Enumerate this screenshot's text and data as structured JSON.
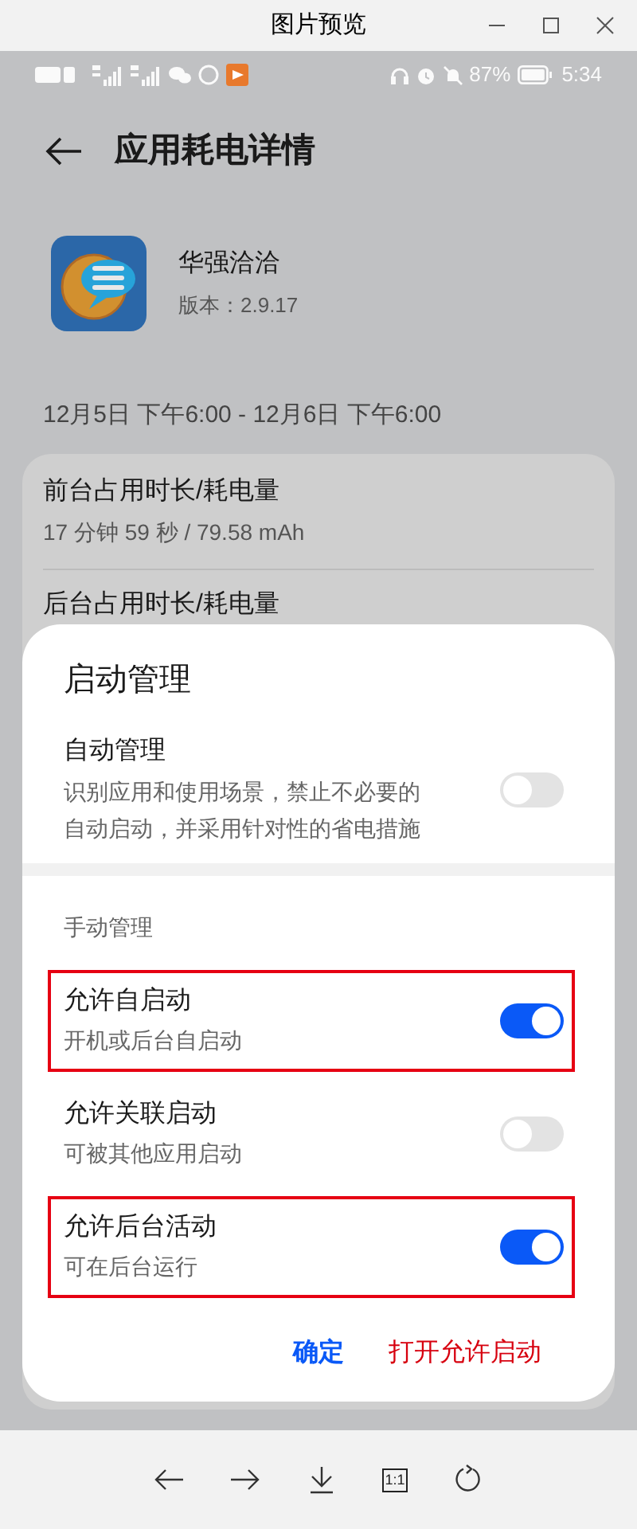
{
  "viewer": {
    "title": "图片预览"
  },
  "status_bar": {
    "battery": "87%",
    "time": "5:34"
  },
  "header": {
    "title": "应用耗电详情"
  },
  "app": {
    "name": "华强洽洽",
    "version": "版本：2.9.17"
  },
  "period": "12月5日 下午6:00 - 12月6日 下午6:00",
  "usage": [
    {
      "label": "前台占用时长/耗电量",
      "value": "17 分钟 59 秒 / 79.58 mAh"
    },
    {
      "label": "后台占用时长/耗电量"
    }
  ],
  "dialog": {
    "title": "启动管理",
    "auto": {
      "label": "自动管理",
      "description": "识别应用和使用场景，禁止不必要的自动启动，并采用针对性的省电措施",
      "on": false
    },
    "section_title": "手动管理",
    "manual": [
      {
        "label": "允许自启动",
        "description": "开机或后台自启动",
        "on": true,
        "highlighted": true
      },
      {
        "label": "允许关联启动",
        "description": "可被其他应用启动",
        "on": false,
        "highlighted": false
      },
      {
        "label": "允许后台活动",
        "description": "可在后台运行",
        "on": true,
        "highlighted": true
      }
    ],
    "buttons": [
      {
        "label": "确定",
        "kind": "confirm"
      },
      {
        "label": "打开允许启动",
        "kind": "action"
      }
    ]
  },
  "toolbar": [
    {
      "kind": "back"
    },
    {
      "kind": "forward"
    },
    {
      "kind": "download"
    },
    {
      "kind": "actual-size",
      "label": "1:1"
    },
    {
      "kind": "rotate"
    }
  ]
}
